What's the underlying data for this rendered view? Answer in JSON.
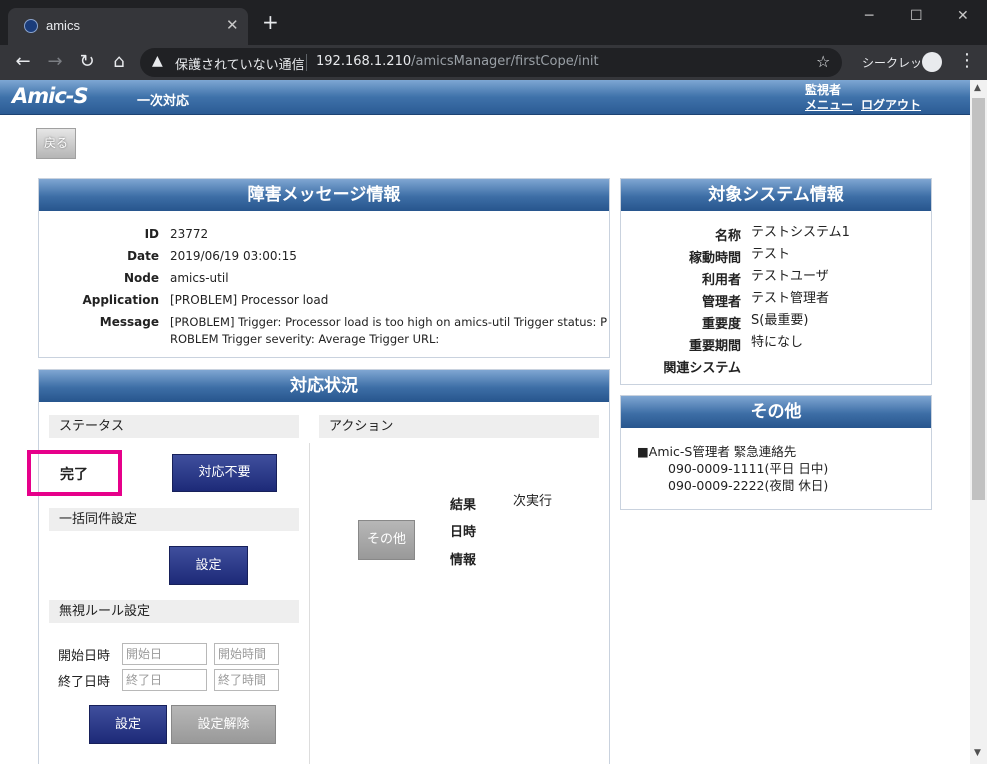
{
  "browser": {
    "tab_title": "amics",
    "tab_close": "✕",
    "new_tab": "+",
    "insecure_label": "保護されていない通信",
    "url_host": "192.168.1.210",
    "url_path": "/amicsManager/firstCope/init",
    "incognito_label": "シークレット"
  },
  "header": {
    "logo": "Amic-S",
    "screen_title": "一次対応",
    "role": "監視者",
    "menu_link": "メニュー",
    "logout_link": "ログアウト"
  },
  "back_button": "戻る",
  "incident": {
    "title": "障害メッセージ情報",
    "fields": [
      {
        "label": "ID",
        "value": "23772"
      },
      {
        "label": "Date",
        "value": "2019/06/19 03:00:15"
      },
      {
        "label": "Node",
        "value": "amics-util"
      },
      {
        "label": "Application",
        "value": "[PROBLEM] Processor load"
      },
      {
        "label": "Message",
        "value": "[PROBLEM] Trigger: Processor load is too high on amics-util Trigger status: P",
        "value2": "ROBLEM Trigger severity: Average Trigger URL:"
      }
    ]
  },
  "system": {
    "title": "対象システム情報",
    "fields": [
      {
        "label": "名称",
        "value": "テストシステム1"
      },
      {
        "label": "稼動時間",
        "value": "テスト"
      },
      {
        "label": "利用者",
        "value": "テストユーザ"
      },
      {
        "label": "管理者",
        "value": "テスト管理者"
      },
      {
        "label": "重要度",
        "value": "S(最重要)"
      },
      {
        "label": "重要期間",
        "value": "特になし"
      },
      {
        "label": "関連システム",
        "value": ""
      }
    ]
  },
  "other": {
    "title": "その他",
    "line1": "■Amic-S管理者 緊急連絡先",
    "line2": "090-0009-1111(平日 日中)",
    "line3": "090-0009-2222(夜間 休日)"
  },
  "response": {
    "title": "対応状況",
    "status_head": "ステータス",
    "status_value": "完了",
    "not_required_btn": "対応不要",
    "bulk_head": "一括同件設定",
    "bulk_set_btn": "設定",
    "ignore_head": "無視ルール設定",
    "start_label": "開始日時",
    "end_label": "終了日時",
    "start_date_ph": "開始日",
    "start_time_ph": "開始時間",
    "end_date_ph": "終了日",
    "end_time_ph": "終了時間",
    "set_btn": "設定",
    "unset_btn": "設定解除",
    "action_head": "アクション",
    "other_btn": "その他",
    "result_label": "結果",
    "result_value": "次実行",
    "datetime_label": "日時",
    "info_label": "情報"
  }
}
